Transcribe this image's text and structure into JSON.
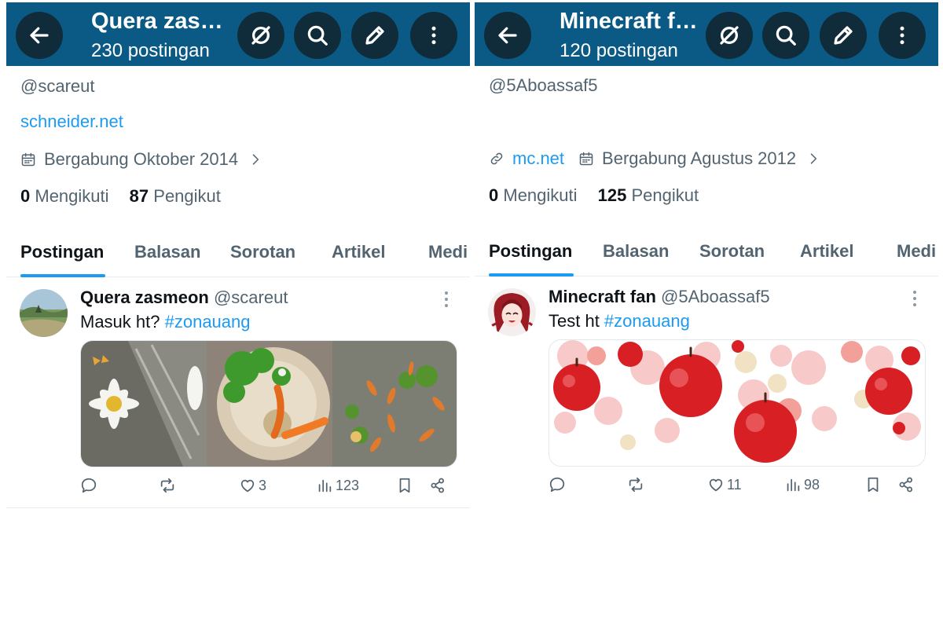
{
  "left": {
    "header": {
      "title": "Quera zasmeon",
      "subtitle": "230 postingan"
    },
    "profile": {
      "handle": "@scareut",
      "website": "schneider.net",
      "link": "",
      "joined": "Bergabung Oktober 2014",
      "following_count": "0",
      "following_label": "Mengikuti",
      "followers_count": "87",
      "followers_label": "Pengikut"
    },
    "tabs": [
      {
        "label": "Postingan",
        "active": true
      },
      {
        "label": "Balasan"
      },
      {
        "label": "Sorotan"
      },
      {
        "label": "Artikel"
      },
      {
        "label": "Medi"
      }
    ],
    "post": {
      "name": "Quera zasmeon",
      "handle": "@scareut",
      "text_prefix": "Masuk ht? ",
      "hashtag": "#zonauang",
      "likes": "3",
      "views": "123"
    }
  },
  "right": {
    "header": {
      "title": "Minecraft fan",
      "subtitle": "120 postingan"
    },
    "profile": {
      "handle": "@5Aboassaf5",
      "website": "",
      "link": "mc.net",
      "joined": "Bergabung Agustus 2012",
      "following_count": "0",
      "following_label": "Mengikuti",
      "followers_count": "125",
      "followers_label": "Pengikut"
    },
    "tabs": [
      {
        "label": "Postingan",
        "active": true
      },
      {
        "label": "Balasan"
      },
      {
        "label": "Sorotan"
      },
      {
        "label": "Artikel"
      },
      {
        "label": "Medi"
      }
    ],
    "post": {
      "name": "Minecraft fan",
      "handle": "@5Aboassaf5",
      "text_prefix": "Test ht ",
      "hashtag": "#zonauang",
      "likes": "11",
      "views": "98"
    }
  },
  "colors": {
    "header_bg": "#0a5a85",
    "button_bg": "#102c3a",
    "accent": "#1d9bf0",
    "secondary_text": "#536471"
  },
  "icons": {
    "back": "arrow-left-icon",
    "no_sync": "slashed-circle-icon",
    "search": "search-icon",
    "compose": "pencil-icon",
    "more": "more-vertical-icon",
    "calendar": "calendar-icon",
    "link": "link-icon",
    "reply": "reply-icon",
    "repost": "repost-icon",
    "like": "heart-icon",
    "views": "views-icon",
    "bookmark": "bookmark-icon",
    "share": "share-icon"
  }
}
